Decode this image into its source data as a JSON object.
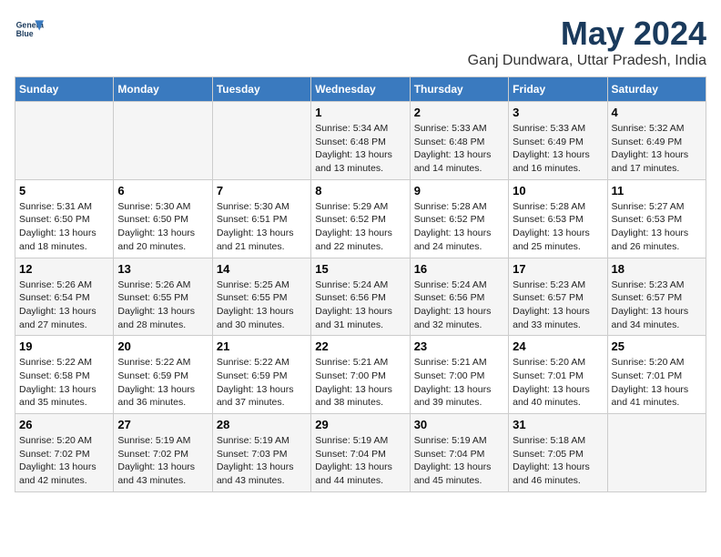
{
  "header": {
    "logo_line1": "General",
    "logo_line2": "Blue",
    "month": "May 2024",
    "location": "Ganj Dundwara, Uttar Pradesh, India"
  },
  "weekdays": [
    "Sunday",
    "Monday",
    "Tuesday",
    "Wednesday",
    "Thursday",
    "Friday",
    "Saturday"
  ],
  "weeks": [
    [
      {
        "day": "",
        "info": ""
      },
      {
        "day": "",
        "info": ""
      },
      {
        "day": "",
        "info": ""
      },
      {
        "day": "1",
        "info": "Sunrise: 5:34 AM\nSunset: 6:48 PM\nDaylight: 13 hours\nand 13 minutes."
      },
      {
        "day": "2",
        "info": "Sunrise: 5:33 AM\nSunset: 6:48 PM\nDaylight: 13 hours\nand 14 minutes."
      },
      {
        "day": "3",
        "info": "Sunrise: 5:33 AM\nSunset: 6:49 PM\nDaylight: 13 hours\nand 16 minutes."
      },
      {
        "day": "4",
        "info": "Sunrise: 5:32 AM\nSunset: 6:49 PM\nDaylight: 13 hours\nand 17 minutes."
      }
    ],
    [
      {
        "day": "5",
        "info": "Sunrise: 5:31 AM\nSunset: 6:50 PM\nDaylight: 13 hours\nand 18 minutes."
      },
      {
        "day": "6",
        "info": "Sunrise: 5:30 AM\nSunset: 6:50 PM\nDaylight: 13 hours\nand 20 minutes."
      },
      {
        "day": "7",
        "info": "Sunrise: 5:30 AM\nSunset: 6:51 PM\nDaylight: 13 hours\nand 21 minutes."
      },
      {
        "day": "8",
        "info": "Sunrise: 5:29 AM\nSunset: 6:52 PM\nDaylight: 13 hours\nand 22 minutes."
      },
      {
        "day": "9",
        "info": "Sunrise: 5:28 AM\nSunset: 6:52 PM\nDaylight: 13 hours\nand 24 minutes."
      },
      {
        "day": "10",
        "info": "Sunrise: 5:28 AM\nSunset: 6:53 PM\nDaylight: 13 hours\nand 25 minutes."
      },
      {
        "day": "11",
        "info": "Sunrise: 5:27 AM\nSunset: 6:53 PM\nDaylight: 13 hours\nand 26 minutes."
      }
    ],
    [
      {
        "day": "12",
        "info": "Sunrise: 5:26 AM\nSunset: 6:54 PM\nDaylight: 13 hours\nand 27 minutes."
      },
      {
        "day": "13",
        "info": "Sunrise: 5:26 AM\nSunset: 6:55 PM\nDaylight: 13 hours\nand 28 minutes."
      },
      {
        "day": "14",
        "info": "Sunrise: 5:25 AM\nSunset: 6:55 PM\nDaylight: 13 hours\nand 30 minutes."
      },
      {
        "day": "15",
        "info": "Sunrise: 5:24 AM\nSunset: 6:56 PM\nDaylight: 13 hours\nand 31 minutes."
      },
      {
        "day": "16",
        "info": "Sunrise: 5:24 AM\nSunset: 6:56 PM\nDaylight: 13 hours\nand 32 minutes."
      },
      {
        "day": "17",
        "info": "Sunrise: 5:23 AM\nSunset: 6:57 PM\nDaylight: 13 hours\nand 33 minutes."
      },
      {
        "day": "18",
        "info": "Sunrise: 5:23 AM\nSunset: 6:57 PM\nDaylight: 13 hours\nand 34 minutes."
      }
    ],
    [
      {
        "day": "19",
        "info": "Sunrise: 5:22 AM\nSunset: 6:58 PM\nDaylight: 13 hours\nand 35 minutes."
      },
      {
        "day": "20",
        "info": "Sunrise: 5:22 AM\nSunset: 6:59 PM\nDaylight: 13 hours\nand 36 minutes."
      },
      {
        "day": "21",
        "info": "Sunrise: 5:22 AM\nSunset: 6:59 PM\nDaylight: 13 hours\nand 37 minutes."
      },
      {
        "day": "22",
        "info": "Sunrise: 5:21 AM\nSunset: 7:00 PM\nDaylight: 13 hours\nand 38 minutes."
      },
      {
        "day": "23",
        "info": "Sunrise: 5:21 AM\nSunset: 7:00 PM\nDaylight: 13 hours\nand 39 minutes."
      },
      {
        "day": "24",
        "info": "Sunrise: 5:20 AM\nSunset: 7:01 PM\nDaylight: 13 hours\nand 40 minutes."
      },
      {
        "day": "25",
        "info": "Sunrise: 5:20 AM\nSunset: 7:01 PM\nDaylight: 13 hours\nand 41 minutes."
      }
    ],
    [
      {
        "day": "26",
        "info": "Sunrise: 5:20 AM\nSunset: 7:02 PM\nDaylight: 13 hours\nand 42 minutes."
      },
      {
        "day": "27",
        "info": "Sunrise: 5:19 AM\nSunset: 7:02 PM\nDaylight: 13 hours\nand 43 minutes."
      },
      {
        "day": "28",
        "info": "Sunrise: 5:19 AM\nSunset: 7:03 PM\nDaylight: 13 hours\nand 43 minutes."
      },
      {
        "day": "29",
        "info": "Sunrise: 5:19 AM\nSunset: 7:04 PM\nDaylight: 13 hours\nand 44 minutes."
      },
      {
        "day": "30",
        "info": "Sunrise: 5:19 AM\nSunset: 7:04 PM\nDaylight: 13 hours\nand 45 minutes."
      },
      {
        "day": "31",
        "info": "Sunrise: 5:18 AM\nSunset: 7:05 PM\nDaylight: 13 hours\nand 46 minutes."
      },
      {
        "day": "",
        "info": ""
      }
    ]
  ]
}
